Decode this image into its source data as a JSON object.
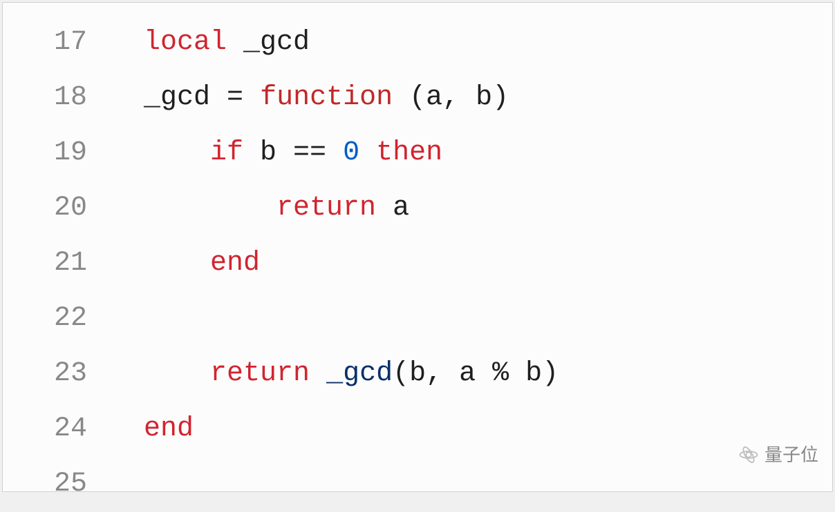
{
  "lines": [
    {
      "num": "17",
      "indent": 0,
      "tokens": [
        {
          "cls": "tok-keyword",
          "text": "local"
        },
        {
          "cls": "tok-ident",
          "text": " _gcd"
        }
      ]
    },
    {
      "num": "18",
      "indent": 0,
      "tokens": [
        {
          "cls": "tok-ident",
          "text": "_gcd "
        },
        {
          "cls": "tok-operator",
          "text": "="
        },
        {
          "cls": "tok-ident",
          "text": " "
        },
        {
          "cls": "tok-function",
          "text": "function"
        },
        {
          "cls": "tok-ident",
          "text": " (a, b)"
        }
      ]
    },
    {
      "num": "19",
      "indent": 1,
      "tokens": [
        {
          "cls": "tok-keyword",
          "text": "if"
        },
        {
          "cls": "tok-ident",
          "text": " b "
        },
        {
          "cls": "tok-operator",
          "text": "=="
        },
        {
          "cls": "tok-ident",
          "text": " "
        },
        {
          "cls": "tok-number",
          "text": "0"
        },
        {
          "cls": "tok-ident",
          "text": " "
        },
        {
          "cls": "tok-keyword",
          "text": "then"
        }
      ]
    },
    {
      "num": "20",
      "indent": 2,
      "tokens": [
        {
          "cls": "tok-keyword",
          "text": "return"
        },
        {
          "cls": "tok-ident",
          "text": " a"
        }
      ]
    },
    {
      "num": "21",
      "indent": 1,
      "tokens": [
        {
          "cls": "tok-keyword",
          "text": "end"
        }
      ]
    },
    {
      "num": "22",
      "indent": 0,
      "tokens": []
    },
    {
      "num": "23",
      "indent": 1,
      "tokens": [
        {
          "cls": "tok-keyword",
          "text": "return"
        },
        {
          "cls": "tok-ident",
          "text": " "
        },
        {
          "cls": "tok-call",
          "text": "_gcd"
        },
        {
          "cls": "tok-ident",
          "text": "(b, a "
        },
        {
          "cls": "tok-operator",
          "text": "%"
        },
        {
          "cls": "tok-ident",
          "text": " b)"
        }
      ]
    },
    {
      "num": "24",
      "indent": 0,
      "tokens": [
        {
          "cls": "tok-keyword",
          "text": "end"
        }
      ]
    },
    {
      "num": "25",
      "indent": 0,
      "tokens": []
    }
  ],
  "indent_unit": "    ",
  "watermark": "量子位"
}
